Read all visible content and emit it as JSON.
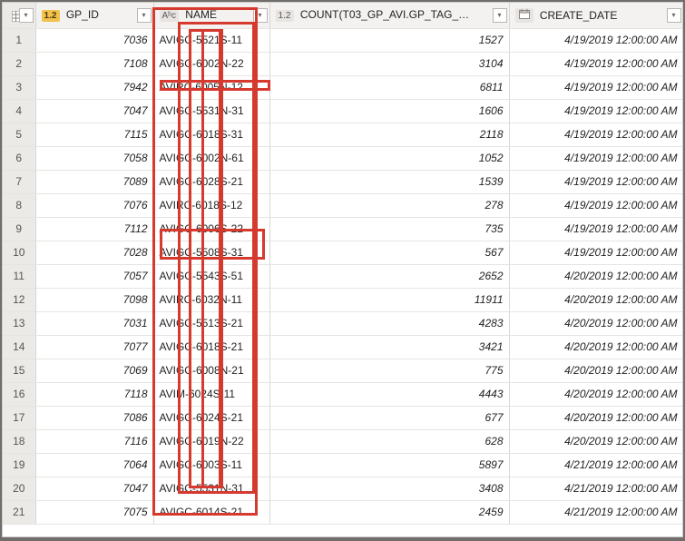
{
  "columns": {
    "gp_id": {
      "type": "1.2",
      "label": "GP_ID"
    },
    "name": {
      "type": "Aᵇc",
      "label": "NAME"
    },
    "count": {
      "type": "1.2",
      "label": "COUNT(T03_GP_AVI.GP_TAG_…"
    },
    "create_date": {
      "label": "CREATE_DATE"
    }
  },
  "rows": [
    {
      "n": "1",
      "id": "7036",
      "name": "AVIGC-5521S-11",
      "cnt": "1527",
      "dt": "4/19/2019 12:00:00 AM"
    },
    {
      "n": "2",
      "id": "7108",
      "name": "AVIGC-6002N-22",
      "cnt": "3104",
      "dt": "4/19/2019 12:00:00 AM"
    },
    {
      "n": "3",
      "id": "7942",
      "name": "AVIRC-6005N-12",
      "cnt": "6811",
      "dt": "4/19/2019 12:00:00 AM"
    },
    {
      "n": "4",
      "id": "7047",
      "name": "AVIGC-5531N-31",
      "cnt": "1606",
      "dt": "4/19/2019 12:00:00 AM"
    },
    {
      "n": "5",
      "id": "7115",
      "name": "AVIGC-6018S-31",
      "cnt": "2118",
      "dt": "4/19/2019 12:00:00 AM"
    },
    {
      "n": "6",
      "id": "7058",
      "name": "AVIGC-6002N-61",
      "cnt": "1052",
      "dt": "4/19/2019 12:00:00 AM"
    },
    {
      "n": "7",
      "id": "7089",
      "name": "AVIGC-6028S-21",
      "cnt": "1539",
      "dt": "4/19/2019 12:00:00 AM"
    },
    {
      "n": "8",
      "id": "7076",
      "name": "AVIRC-6018S-12",
      "cnt": "278",
      "dt": "4/19/2019 12:00:00 AM"
    },
    {
      "n": "9",
      "id": "7112",
      "name": "AVIGC-6006S-22",
      "cnt": "735",
      "dt": "4/19/2019 12:00:00 AM"
    },
    {
      "n": "10",
      "id": "7028",
      "name": "AVIGC-5508S-31",
      "cnt": "567",
      "dt": "4/19/2019 12:00:00 AM"
    },
    {
      "n": "11",
      "id": "7057",
      "name": "AVIGC-5543S-51",
      "cnt": "2652",
      "dt": "4/20/2019 12:00:00 AM"
    },
    {
      "n": "12",
      "id": "7098",
      "name": "AVIRC-6032N-11",
      "cnt": "11911",
      "dt": "4/20/2019 12:00:00 AM"
    },
    {
      "n": "13",
      "id": "7031",
      "name": "AVIGC-5513S-21",
      "cnt": "4283",
      "dt": "4/20/2019 12:00:00 AM"
    },
    {
      "n": "14",
      "id": "7077",
      "name": "AVIGC-6018S-21",
      "cnt": "3421",
      "dt": "4/20/2019 12:00:00 AM"
    },
    {
      "n": "15",
      "id": "7069",
      "name": "AVIGC-6008N-21",
      "cnt": "775",
      "dt": "4/20/2019 12:00:00 AM"
    },
    {
      "n": "16",
      "id": "7118",
      "name": "AVIM-6024S-11",
      "cnt": "4443",
      "dt": "4/20/2019 12:00:00 AM"
    },
    {
      "n": "17",
      "id": "7086",
      "name": "AVIGC-6024S-21",
      "cnt": "677",
      "dt": "4/20/2019 12:00:00 AM"
    },
    {
      "n": "18",
      "id": "7116",
      "name": "AVIGC-6019N-22",
      "cnt": "628",
      "dt": "4/20/2019 12:00:00 AM"
    },
    {
      "n": "19",
      "id": "7064",
      "name": "AVIGC-6003S-11",
      "cnt": "5897",
      "dt": "4/21/2019 12:00:00 AM"
    },
    {
      "n": "20",
      "id": "7047",
      "name": "AVIGC-5531N-31",
      "cnt": "3408",
      "dt": "4/21/2019 12:00:00 AM"
    },
    {
      "n": "21",
      "id": "7075",
      "name": "AVIGC-6014S-21",
      "cnt": "2459",
      "dt": "4/21/2019 12:00:00 AM"
    }
  ]
}
